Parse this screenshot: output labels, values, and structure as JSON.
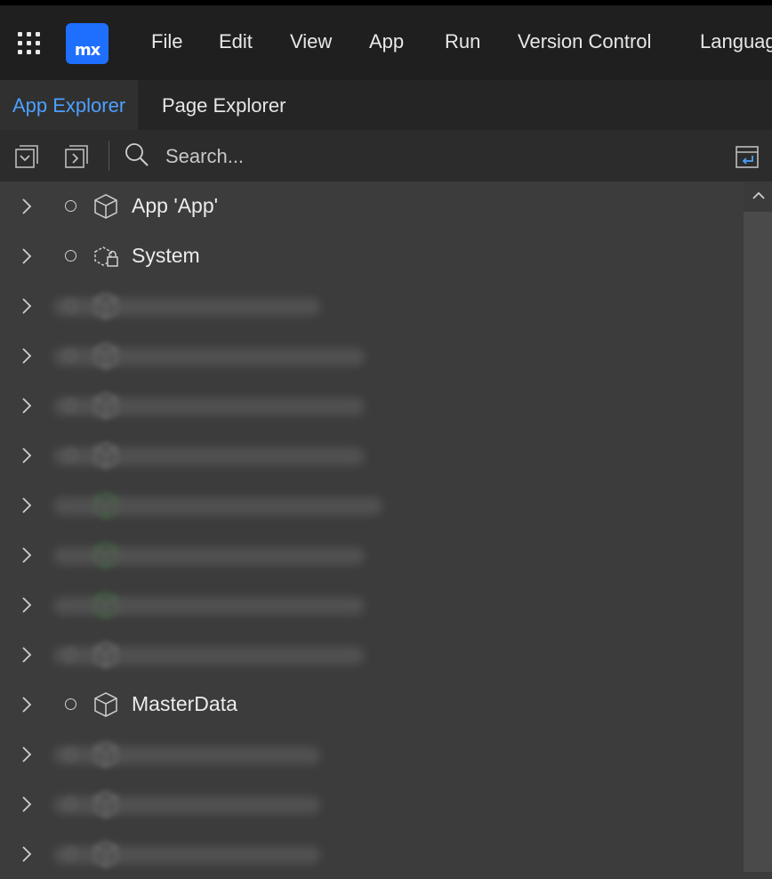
{
  "menubar": {
    "items": [
      "File",
      "Edit",
      "View",
      "App",
      "Run",
      "Version Control",
      "Languag"
    ],
    "logo_text": "mx",
    "logo_color": "#1f6fff"
  },
  "tabs": [
    {
      "label": "App Explorer",
      "active": true
    },
    {
      "label": "Page Explorer",
      "active": false
    }
  ],
  "toolbar": {
    "search_placeholder": "Search...",
    "icons": [
      "collapse-all-icon",
      "expand-all-icon",
      "search-icon",
      "link-editor-icon"
    ]
  },
  "tree": {
    "rows": [
      {
        "label": "App 'App'",
        "icon": "cube-icon",
        "blurred": false,
        "status": "none"
      },
      {
        "label": "System",
        "icon": "system-module-icon",
        "blurred": false,
        "status": "none"
      },
      {
        "label": "",
        "icon": "module-icon",
        "blurred": true,
        "status": "none"
      },
      {
        "label": "",
        "icon": "module-icon",
        "blurred": true,
        "status": "none"
      },
      {
        "label": "",
        "icon": "module-icon",
        "blurred": true,
        "status": "none"
      },
      {
        "label": "",
        "icon": "module-icon",
        "blurred": true,
        "status": "none"
      },
      {
        "label": "",
        "icon": "module-icon",
        "blurred": true,
        "status": "green"
      },
      {
        "label": "",
        "icon": "module-icon",
        "blurred": true,
        "status": "green"
      },
      {
        "label": "",
        "icon": "module-icon",
        "blurred": true,
        "status": "green"
      },
      {
        "label": "",
        "icon": "module-icon",
        "blurred": true,
        "status": "none"
      },
      {
        "label": "MasterData",
        "icon": "cube-icon",
        "blurred": false,
        "status": "none"
      },
      {
        "label": "",
        "icon": "module-icon",
        "blurred": true,
        "status": "none"
      },
      {
        "label": "",
        "icon": "module-icon",
        "blurred": true,
        "status": "none"
      },
      {
        "label": "",
        "icon": "module-icon",
        "blurred": true,
        "status": "none"
      }
    ]
  },
  "colors": {
    "accent": "#4ca0ff",
    "status_green": "#3fbf3f"
  }
}
